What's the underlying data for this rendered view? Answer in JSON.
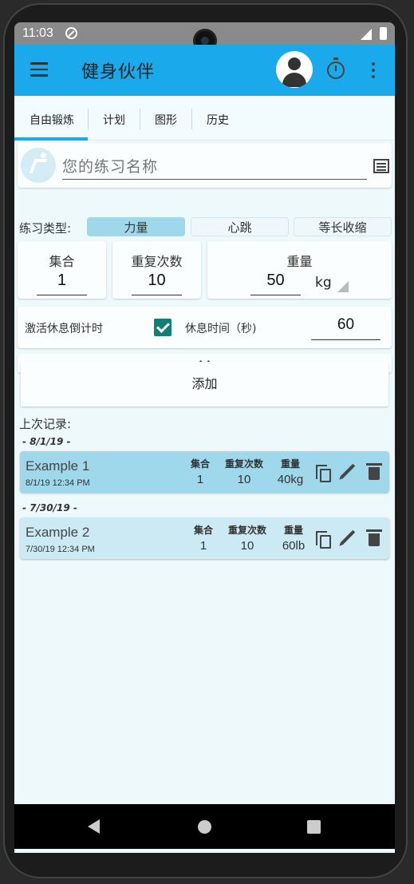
{
  "status": {
    "time": "11:03"
  },
  "appbar": {
    "title": "健身伙伴"
  },
  "tabs": [
    {
      "label": "自由锻炼"
    },
    {
      "label": "计划"
    },
    {
      "label": "图形"
    },
    {
      "label": "历史"
    }
  ],
  "workout": {
    "name_placeholder": "您的练习名称"
  },
  "type": {
    "label": "练习类型:",
    "options": [
      "力量",
      "心跳",
      "等长收缩"
    ],
    "selected": "力量"
  },
  "fields": {
    "sets_label": "集合",
    "sets_value": "1",
    "reps_label": "重复次数",
    "reps_value": "10",
    "weight_label": "重量",
    "weight_value": "50",
    "weight_unit": "kg"
  },
  "rest": {
    "toggle_label": "激活休息倒计时",
    "checked": true,
    "time_label": "休息时间（秒)",
    "time_value": "60"
  },
  "add_button": "添加",
  "history": {
    "label": "上次记录:",
    "groups": [
      {
        "date": "- 8/1/19 -",
        "entry": {
          "name": "Example 1",
          "timestamp": "8/1/19  12:34 PM",
          "sets_label": "集合",
          "sets": "1",
          "reps_label": "重复次数",
          "reps": "10",
          "weight_label": "重量",
          "weight": "40kg"
        }
      },
      {
        "date": "- 7/30/19 -",
        "entry": {
          "name": "Example 2",
          "timestamp": "7/30/19  12:34 PM",
          "sets_label": "集合",
          "sets": "1",
          "reps_label": "重复次数",
          "reps": "10",
          "weight_label": "重量",
          "weight": "60lb"
        }
      }
    ]
  },
  "colors": {
    "primary": "#1aa9ea",
    "selected_type": "#9fd8ea",
    "checkbox": "#0e8077",
    "entry1": "#9fd8ea",
    "entry2": "#cbeaf3"
  }
}
